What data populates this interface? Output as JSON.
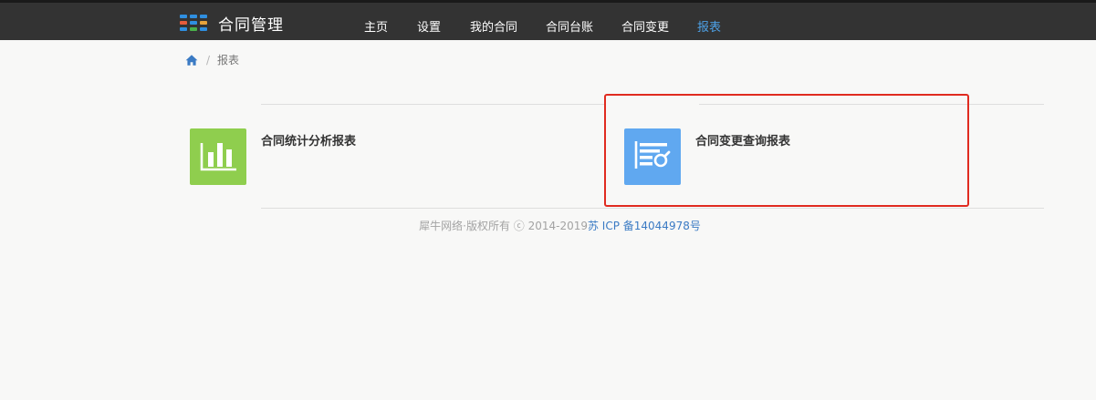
{
  "header": {
    "app_title": "合同管理",
    "brand_icon_colors": [
      "#2f8fe0",
      "#2f8fe0",
      "#2f8fe0",
      "#e55c3c",
      "#2f8fe0",
      "#e5a23c",
      "#2f8fe0",
      "#4ab04a",
      "#2f8fe0"
    ]
  },
  "nav": {
    "items": [
      {
        "label": "主页"
      },
      {
        "label": "设置"
      },
      {
        "label": "我的合同"
      },
      {
        "label": "合同台账"
      },
      {
        "label": "合同变更"
      },
      {
        "label": "报表",
        "active": true
      }
    ]
  },
  "breadcrumb": {
    "home_icon": "home-icon",
    "separator": "/",
    "current": "报表"
  },
  "reports": [
    {
      "title": "合同统计分析报表",
      "icon": "bar-chart-icon",
      "color": "#8fce4e"
    },
    {
      "title": "合同变更查询报表",
      "icon": "list-search-icon",
      "color": "#60a8f0"
    }
  ],
  "footer": {
    "copyright": "犀牛网络·版权所有 ⓒ 2014-2019",
    "icp": "苏 ICP 备14044978号"
  },
  "colors": {
    "navbar_bg": "#333333",
    "active_nav": "#4ea1e6",
    "highlight_border": "#e02b20",
    "link": "#3b7bc4"
  }
}
